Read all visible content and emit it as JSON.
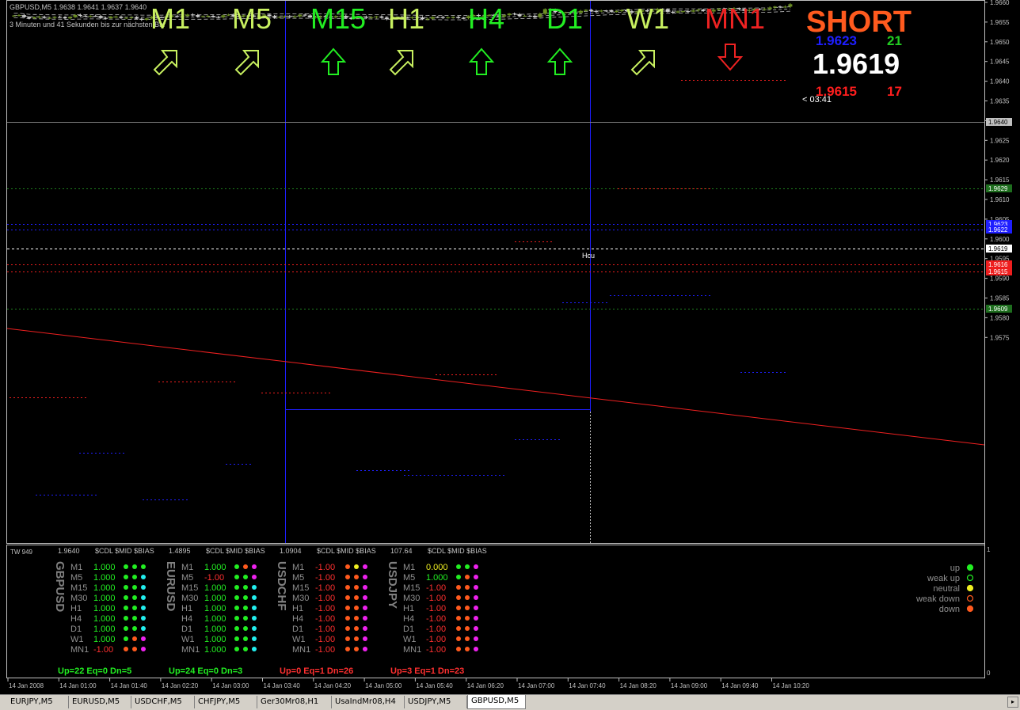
{
  "header": {
    "symbol_line": "GBPUSD,M5  1.9638 1.9641 1.9637 1.9640",
    "timer_line": "3 Minuten und 41 Sekunden bis zur nächsten Bar"
  },
  "timeframes": [
    {
      "label": "M1",
      "color": "#c8f060",
      "arrow": "up-right"
    },
    {
      "label": "M5",
      "color": "#c8f060",
      "arrow": "up-right"
    },
    {
      "label": "M15",
      "color": "#22ee22",
      "arrow": "up"
    },
    {
      "label": "H1",
      "color": "#c8f060",
      "arrow": "up-right"
    },
    {
      "label": "H4",
      "color": "#22ee22",
      "arrow": "up"
    },
    {
      "label": "D1",
      "color": "#22ee22",
      "arrow": "up"
    },
    {
      "label": "W1",
      "color": "#c8f060",
      "arrow": "up-right"
    },
    {
      "label": "MN1",
      "color": "#ee2222",
      "arrow": "down"
    }
  ],
  "signal": {
    "direction": "SHORT",
    "direction_color": "#ff5a1e",
    "ask": "1.9623",
    "ask_color": "#1e1eff",
    "ask_spread": "21",
    "bid_main": "1.9619",
    "bid": "1.9615",
    "bid_color": "#ff1e1e",
    "bid_spread": "17",
    "countdown": "< 03:41"
  },
  "price_axis": {
    "labels": [
      "1.9660",
      "1.9655",
      "1.9650",
      "1.9645",
      "1.9640",
      "1.9635",
      "1.9630",
      "1.9625",
      "1.9620",
      "1.9615",
      "1.9610",
      "1.9605",
      "1.9600",
      "1.9595",
      "1.9590",
      "1.9585",
      "1.9580",
      "1.9575"
    ],
    "current": "1.9640",
    "bid_tag": "1.9619",
    "markers": [
      {
        "text": "1.9629",
        "color": "#1e6e1e"
      },
      {
        "text": "1.9623",
        "color": "#1e1eff"
      },
      {
        "text": "1.9622",
        "color": "#1e1eff"
      },
      {
        "text": "1.9616",
        "color": "#ee1e1e"
      },
      {
        "text": "1.9615",
        "color": "#ee1e1e"
      },
      {
        "text": "1.9609",
        "color": "#1e6e1e"
      }
    ]
  },
  "chart_annotation": "Hcu",
  "time_axis": [
    "14 Jan 2008",
    "14 Jan 01:00",
    "14 Jan 01:40",
    "14 Jan 02:20",
    "14 Jan 03:00",
    "14 Jan 03:40",
    "14 Jan 04:20",
    "14 Jan 05:00",
    "14 Jan 05:40",
    "14 Jan 06:20",
    "14 Jan 07:00",
    "14 Jan 07:40",
    "14 Jan 08:20",
    "14 Jan 09:00",
    "14 Jan 09:40",
    "14 Jan 10:20"
  ],
  "indicator": {
    "name": "TW 949",
    "scale_top": "1",
    "scale_bottom": "0",
    "pairs": [
      {
        "symbol": "GBPUSD",
        "price": "1.9640",
        "header": "$CDL $MID $BIAS",
        "rows": [
          {
            "tf": "M1",
            "val": "1.000",
            "vc": "#22ee22",
            "dots": [
              "#22ee22",
              "#22ee22",
              "#22ee22"
            ]
          },
          {
            "tf": "M5",
            "val": "1.000",
            "vc": "#22ee22",
            "dots": [
              "#22ee22",
              "#22ee22",
              "#22eeee"
            ]
          },
          {
            "tf": "M15",
            "val": "1.000",
            "vc": "#22ee22",
            "dots": [
              "#22ee22",
              "#22ee22",
              "#22eeee"
            ]
          },
          {
            "tf": "M30",
            "val": "1.000",
            "vc": "#22ee22",
            "dots": [
              "#22ee22",
              "#22ee22",
              "#22eeee"
            ]
          },
          {
            "tf": "H1",
            "val": "1.000",
            "vc": "#22ee22",
            "dots": [
              "#22ee22",
              "#22ee22",
              "#22eeee"
            ]
          },
          {
            "tf": "H4",
            "val": "1.000",
            "vc": "#22ee22",
            "dots": [
              "#22ee22",
              "#22ee22",
              "#22eeee"
            ]
          },
          {
            "tf": "D1",
            "val": "1.000",
            "vc": "#22ee22",
            "dots": [
              "#22ee22",
              "#22ee22",
              "#22eeee"
            ]
          },
          {
            "tf": "W1",
            "val": "1.000",
            "vc": "#22ee22",
            "dots": [
              "#22ee22",
              "#ff5a1e",
              "#ee22ee"
            ]
          },
          {
            "tf": "MN1",
            "val": "-1.00",
            "vc": "#ff3030",
            "dots": [
              "#ff5a1e",
              "#ff5a1e",
              "#ee22ee"
            ]
          }
        ],
        "summary": "Up=22 Eq=0 Dn=5",
        "summary_color": "#22ee22"
      },
      {
        "symbol": "EURUSD",
        "price": "1.4895",
        "header": "$CDL $MID $BIAS",
        "rows": [
          {
            "tf": "M1",
            "val": "1.000",
            "vc": "#22ee22",
            "dots": [
              "#22ee22",
              "#ff5a1e",
              "#ee22ee"
            ]
          },
          {
            "tf": "M5",
            "val": "-1.00",
            "vc": "#ff3030",
            "dots": [
              "#22ee22",
              "#22ee22",
              "#ee22ee"
            ]
          },
          {
            "tf": "M15",
            "val": "1.000",
            "vc": "#22ee22",
            "dots": [
              "#22ee22",
              "#22ee22",
              "#22eeee"
            ]
          },
          {
            "tf": "M30",
            "val": "1.000",
            "vc": "#22ee22",
            "dots": [
              "#22ee22",
              "#22ee22",
              "#22eeee"
            ]
          },
          {
            "tf": "H1",
            "val": "1.000",
            "vc": "#22ee22",
            "dots": [
              "#22ee22",
              "#22ee22",
              "#22eeee"
            ]
          },
          {
            "tf": "H4",
            "val": "1.000",
            "vc": "#22ee22",
            "dots": [
              "#22ee22",
              "#22ee22",
              "#22eeee"
            ]
          },
          {
            "tf": "D1",
            "val": "1.000",
            "vc": "#22ee22",
            "dots": [
              "#22ee22",
              "#22ee22",
              "#22eeee"
            ]
          },
          {
            "tf": "W1",
            "val": "1.000",
            "vc": "#22ee22",
            "dots": [
              "#22ee22",
              "#22ee22",
              "#22eeee"
            ]
          },
          {
            "tf": "MN1",
            "val": "1.000",
            "vc": "#22ee22",
            "dots": [
              "#22ee22",
              "#22ee22",
              "#22eeee"
            ]
          }
        ],
        "summary": "Up=24 Eq=0 Dn=3",
        "summary_color": "#22ee22"
      },
      {
        "symbol": "USDCHF",
        "price": "1.0904",
        "header": "$CDL $MID $BIAS",
        "rows": [
          {
            "tf": "M1",
            "val": "-1.00",
            "vc": "#ff3030",
            "dots": [
              "#ff5a1e",
              "#eeee22",
              "#ee22ee"
            ]
          },
          {
            "tf": "M5",
            "val": "-1.00",
            "vc": "#ff3030",
            "dots": [
              "#ff5a1e",
              "#ff5a1e",
              "#ee22ee"
            ]
          },
          {
            "tf": "M15",
            "val": "-1.00",
            "vc": "#ff3030",
            "dots": [
              "#ff5a1e",
              "#ff5a1e",
              "#ee22ee"
            ]
          },
          {
            "tf": "M30",
            "val": "-1.00",
            "vc": "#ff3030",
            "dots": [
              "#ff5a1e",
              "#ff5a1e",
              "#ee22ee"
            ]
          },
          {
            "tf": "H1",
            "val": "-1.00",
            "vc": "#ff3030",
            "dots": [
              "#ff5a1e",
              "#ff5a1e",
              "#ee22ee"
            ]
          },
          {
            "tf": "H4",
            "val": "-1.00",
            "vc": "#ff3030",
            "dots": [
              "#ff5a1e",
              "#ff5a1e",
              "#ee22ee"
            ]
          },
          {
            "tf": "D1",
            "val": "-1.00",
            "vc": "#ff3030",
            "dots": [
              "#ff5a1e",
              "#ff5a1e",
              "#ee22ee"
            ]
          },
          {
            "tf": "W1",
            "val": "-1.00",
            "vc": "#ff3030",
            "dots": [
              "#ff5a1e",
              "#ff5a1e",
              "#ee22ee"
            ]
          },
          {
            "tf": "MN1",
            "val": "-1.00",
            "vc": "#ff3030",
            "dots": [
              "#ff5a1e",
              "#ff5a1e",
              "#ee22ee"
            ]
          }
        ],
        "summary": "Up=0 Eq=1 Dn=26",
        "summary_color": "#ff3030"
      },
      {
        "symbol": "USDJPY",
        "price": "107.64",
        "header": "$CDL $MID $BIAS",
        "rows": [
          {
            "tf": "M1",
            "val": "0.000",
            "vc": "#eeee22",
            "dots": [
              "#22ee22",
              "#22ee22",
              "#ee22ee"
            ]
          },
          {
            "tf": "M5",
            "val": "1.000",
            "vc": "#22ee22",
            "dots": [
              "#22ee22",
              "#ff5a1e",
              "#ee22ee"
            ]
          },
          {
            "tf": "M15",
            "val": "-1.00",
            "vc": "#ff3030",
            "dots": [
              "#ff5a1e",
              "#ff5a1e",
              "#ee22ee"
            ]
          },
          {
            "tf": "M30",
            "val": "-1.00",
            "vc": "#ff3030",
            "dots": [
              "#ff5a1e",
              "#ff5a1e",
              "#ee22ee"
            ]
          },
          {
            "tf": "H1",
            "val": "-1.00",
            "vc": "#ff3030",
            "dots": [
              "#ff5a1e",
              "#ff5a1e",
              "#ee22ee"
            ]
          },
          {
            "tf": "H4",
            "val": "-1.00",
            "vc": "#ff3030",
            "dots": [
              "#ff5a1e",
              "#ff5a1e",
              "#ee22ee"
            ]
          },
          {
            "tf": "D1",
            "val": "-1.00",
            "vc": "#ff3030",
            "dots": [
              "#ff5a1e",
              "#ff5a1e",
              "#ee22ee"
            ]
          },
          {
            "tf": "W1",
            "val": "-1.00",
            "vc": "#ff3030",
            "dots": [
              "#ff5a1e",
              "#ff5a1e",
              "#ee22ee"
            ]
          },
          {
            "tf": "MN1",
            "val": "-1.00",
            "vc": "#ff3030",
            "dots": [
              "#ff5a1e",
              "#ff5a1e",
              "#ee22ee"
            ]
          }
        ],
        "summary": "Up=3 Eq=1 Dn=23",
        "summary_color": "#ff3030"
      }
    ],
    "legend": [
      {
        "label": "up",
        "color": "#22ee22",
        "filled": true
      },
      {
        "label": "weak up",
        "color": "#22ee22",
        "filled": false
      },
      {
        "label": "neutral",
        "color": "#eeee22",
        "filled": true
      },
      {
        "label": "weak down",
        "color": "#ff5a1e",
        "filled": false
      },
      {
        "label": "down",
        "color": "#ff5a1e",
        "filled": true
      }
    ]
  },
  "tabs": [
    {
      "label": "EURJPY,M5",
      "active": false
    },
    {
      "label": "EURUSD,M5",
      "active": false
    },
    {
      "label": "USDCHF,M5",
      "active": false
    },
    {
      "label": "CHFJPY,M5",
      "active": false
    },
    {
      "label": "Ger30Mr08,H1",
      "active": false
    },
    {
      "label": "UsaIndMr08,H4",
      "active": false
    },
    {
      "label": "USDJPY,M5",
      "active": false
    },
    {
      "label": "GBPUSD,M5",
      "active": true
    }
  ]
}
